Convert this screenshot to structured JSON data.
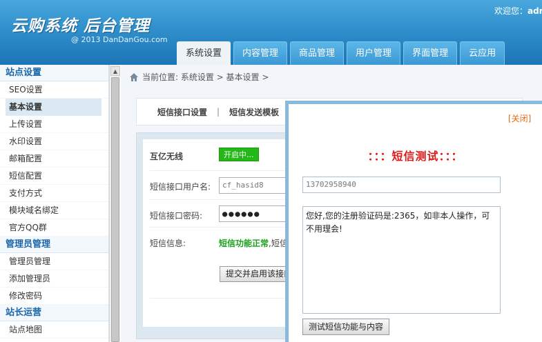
{
  "header": {
    "title": "云购系统 后台管理",
    "copyright": "@ 2013  DanDanGou.com",
    "welcome_label": "欢迎您：",
    "username": "adr"
  },
  "tabs": [
    {
      "label": "系统设置",
      "active": true
    },
    {
      "label": "内容管理",
      "active": false
    },
    {
      "label": "商品管理",
      "active": false
    },
    {
      "label": "用户管理",
      "active": false
    },
    {
      "label": "界面管理",
      "active": false
    },
    {
      "label": "云应用",
      "active": false
    }
  ],
  "sidebar": {
    "groups": [
      {
        "title": "站点设置",
        "items": [
          "SEO设置",
          "基本设置",
          "上传设置",
          "水印设置",
          "邮箱配置",
          "短信配置",
          "支付方式",
          "模块域名绑定",
          "官方QQ群"
        ]
      },
      {
        "title": "管理员管理",
        "items": [
          "管理员管理",
          "添加管理员",
          "修改密码"
        ]
      },
      {
        "title": "站长运营",
        "items": [
          "站点地图"
        ]
      }
    ],
    "active_item": "基本设置"
  },
  "breadcrumb": "当前位置: 系统设置 > 基本设置 >",
  "subnav": {
    "item1": "短信接口设置",
    "separator": "|",
    "item2": "短信发送模板"
  },
  "form": {
    "provider_label": "互亿无线",
    "provider_status": "开启中...",
    "username_label": "短信接口用户名:",
    "username_value": "cf_hasid8",
    "password_label": "短信接口密码:",
    "password_value": "●●●●●●",
    "info_label": "短信信息:",
    "info_ok": "短信功能正常",
    "info_rest": ",短信",
    "submit_label": "提交并启用该接口"
  },
  "modal": {
    "close_label": "[关闭]",
    "title": "：：：短信测试：：：",
    "phone_value": "13702958940",
    "message": "您好,您的注册验证码是:2365，如非本人操作，可不用理会!",
    "test_button": "测试短信功能与内容"
  },
  "colors": {
    "header_blue": "#2f8fcb",
    "status_green": "#23b817",
    "title_red": "#e01818",
    "close_orange": "#e06a10"
  }
}
